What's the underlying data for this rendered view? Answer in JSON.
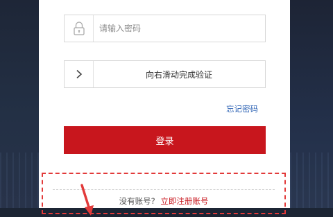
{
  "password": {
    "placeholder": "请输入密码",
    "value": "",
    "icon": "lock-icon"
  },
  "slider": {
    "text": "向右滑动完成验证",
    "handle_icon": "chevron-right-icon"
  },
  "forgot_password": {
    "label": "忘记密码"
  },
  "login": {
    "label": "登录"
  },
  "register": {
    "prompt": "没有账号?",
    "link": "立即注册账号"
  },
  "colors": {
    "brand_red": "#c8161d",
    "link_blue": "#2f64b5",
    "highlight_red": "#e23a3a"
  }
}
